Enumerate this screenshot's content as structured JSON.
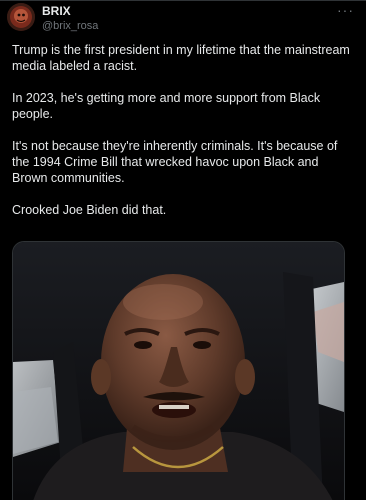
{
  "author": {
    "display_name": "BRIX",
    "handle": "@brix_rosa",
    "avatar_icon": "profile-avatar"
  },
  "menu": {
    "more_icon": "more-horizontal-icon",
    "glyph": "···"
  },
  "post": {
    "paragraphs": [
      "Trump is the first president in my lifetime that the mainstream media labeled a racist.",
      "In 2023, he's getting more and more support from Black people.",
      "It's not because they're inherently criminals.  It's because of the 1994 Crime Bill that wrecked havoc upon Black and Brown communities.",
      "Crooked Joe Biden did that."
    ]
  },
  "media": {
    "type": "video-thumbnail"
  },
  "colors": {
    "background": "#000000",
    "text_primary": "#e7e9ea",
    "text_secondary": "#71767b",
    "border": "#2f3336"
  }
}
